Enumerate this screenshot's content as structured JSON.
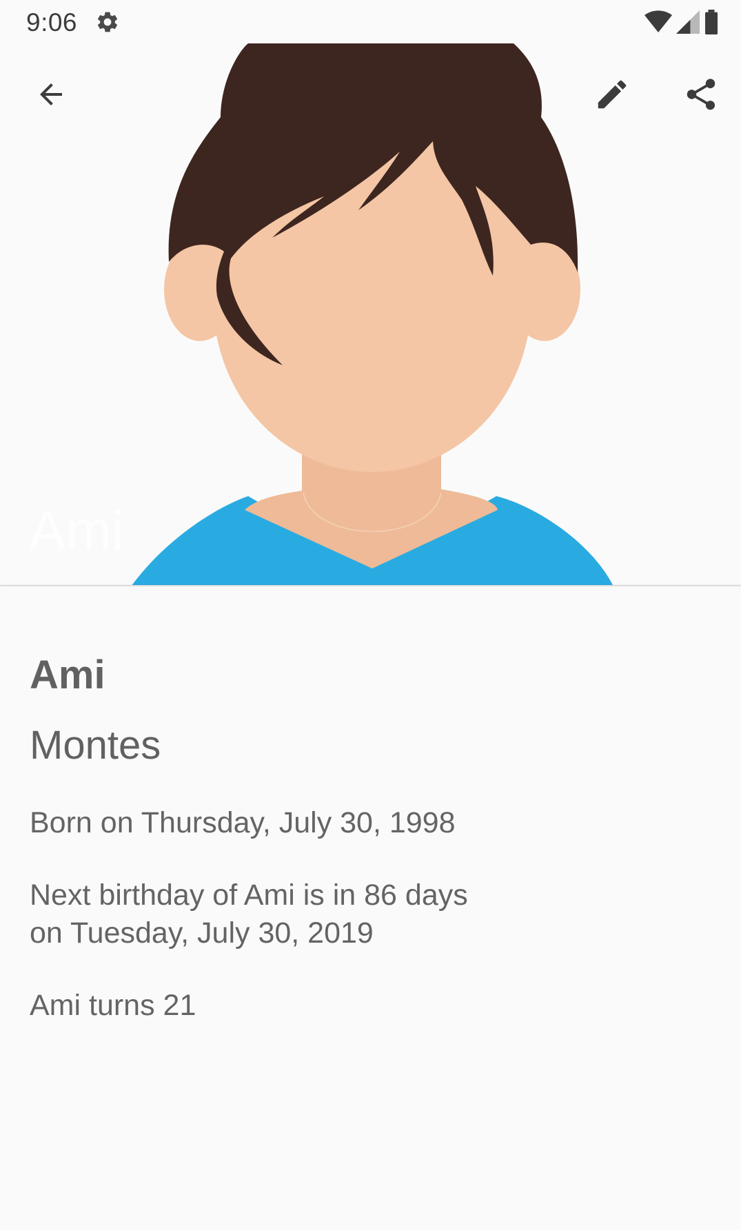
{
  "status_bar": {
    "time": "9:06",
    "icons": [
      "gear-icon",
      "wifi-icon",
      "signal-icon",
      "battery-icon"
    ]
  },
  "toolbar": {
    "back_icon": "arrow-back-icon",
    "edit_icon": "pencil-icon",
    "share_icon": "share-icon"
  },
  "header": {
    "overlay_name": "Ami",
    "colors": {
      "hair": "#3e2620",
      "skin": "#f4c6a5",
      "neck": "#eeba97",
      "shirt": "#29abe2"
    }
  },
  "contact": {
    "first_name": "Ami",
    "last_name": "Montes",
    "born": "Born on Thursday, July 30, 1998",
    "next_birthday_line1": "Next birthday of Ami is in 86 days",
    "next_birthday_line2": "on Tuesday, July 30, 2019",
    "turns": "Ami turns 21"
  }
}
